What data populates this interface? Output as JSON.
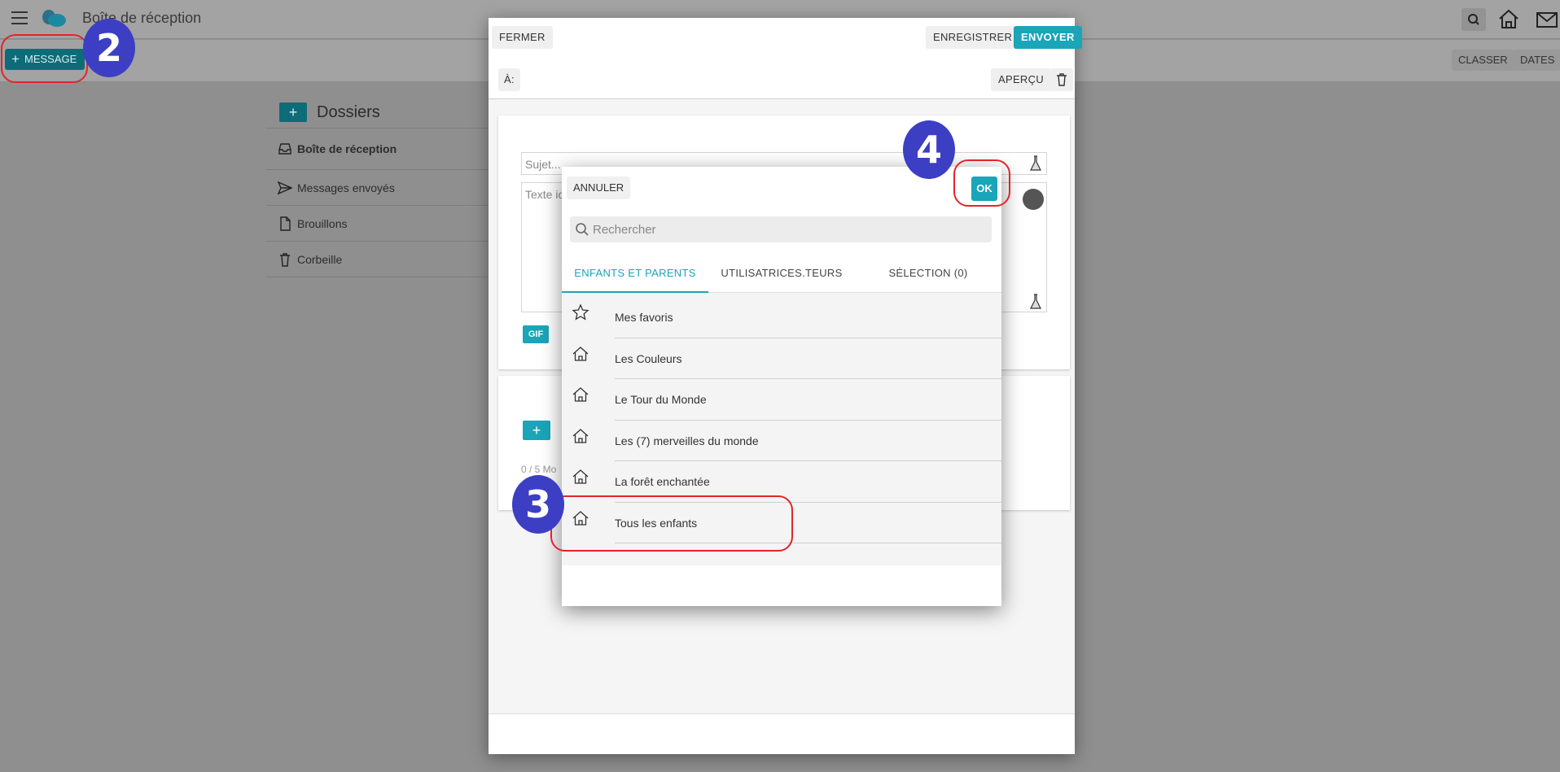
{
  "app": {
    "title": "Boîte de réception"
  },
  "toolbar": {
    "new_message_label": "MESSAGE",
    "classer_label": "CLASSER",
    "dates_label": "DATES"
  },
  "folders": {
    "title": "Dossiers",
    "items": [
      {
        "label": "Boîte de réception",
        "icon": "inbox-icon"
      },
      {
        "label": "Messages envoyés",
        "icon": "send-icon"
      },
      {
        "label": "Brouillons",
        "icon": "draft-file-icon"
      },
      {
        "label": "Corbeille",
        "icon": "trash-icon"
      }
    ]
  },
  "compose": {
    "close_label": "FERMER",
    "save_label": "ENREGISTRER",
    "send_label": "ENVOYER",
    "to_label": "À:",
    "preview_label": "APERÇU",
    "subject_placeholder": "Sujet...",
    "body_placeholder": "Texte ici",
    "gif_label": "GIF",
    "attachment_size": "0 / 5 Mo"
  },
  "picker": {
    "cancel_label": "ANNULER",
    "ok_label": "OK",
    "search_placeholder": "Rechercher",
    "tabs": [
      {
        "label": "ENFANTS ET PARENTS",
        "active": true
      },
      {
        "label": "UTILISATRICES.TEURS",
        "active": false
      },
      {
        "label": "SÉLECTION (0)",
        "active": false
      }
    ],
    "items": [
      {
        "label": "Mes favoris",
        "icon": "star-icon"
      },
      {
        "label": "Les Couleurs",
        "icon": "home-icon"
      },
      {
        "label": "Le Tour du Monde",
        "icon": "home-icon"
      },
      {
        "label": "Les (7) merveilles du monde",
        "icon": "home-icon"
      },
      {
        "label": "La forêt enchantée",
        "icon": "home-icon"
      },
      {
        "label": "Tous les enfants",
        "icon": "home-icon"
      }
    ]
  },
  "annotations": {
    "step_2": "2",
    "step_3": "3",
    "step_4": "4",
    "highlight_color": "#e3242b",
    "badge_color": "#3c3fc4"
  },
  "colors": {
    "accent": "#1aa5b8",
    "accent_dark": "#0e6c78"
  }
}
